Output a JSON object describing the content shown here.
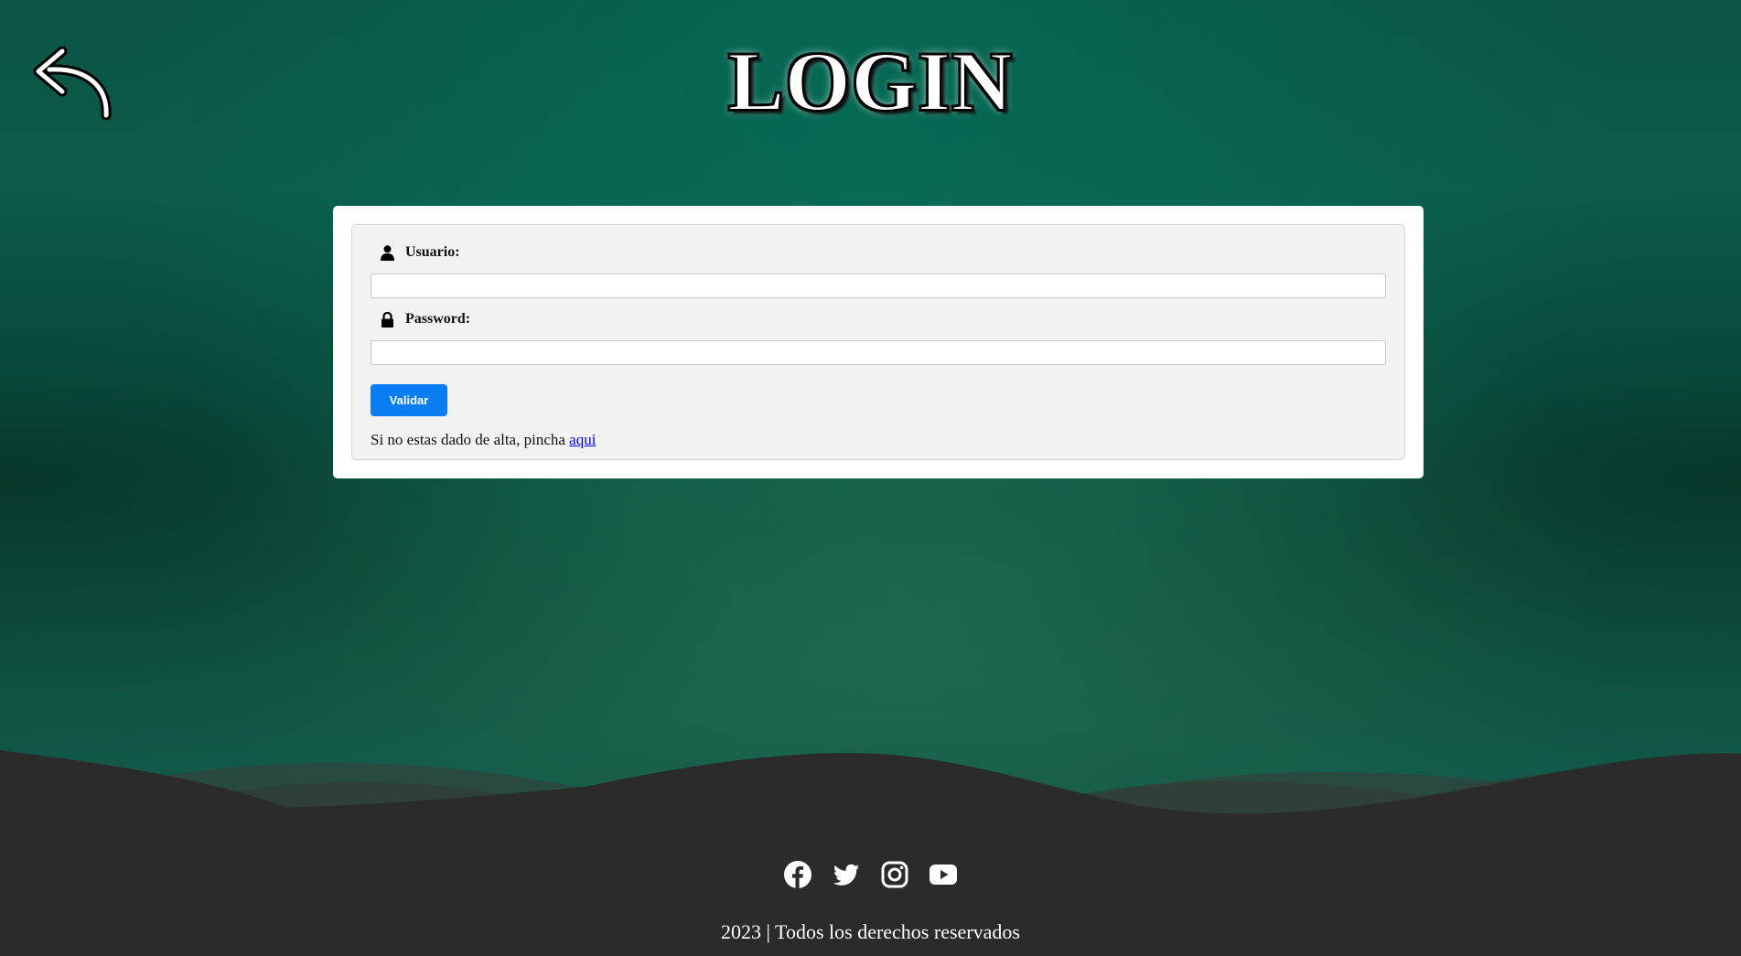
{
  "header": {
    "back_icon": "back-arrow-icon",
    "title": "LOGIN"
  },
  "form": {
    "username": {
      "icon": "user-icon",
      "label": "Usuario:",
      "value": "",
      "placeholder": ""
    },
    "password": {
      "icon": "lock-icon",
      "label": "Password:",
      "value": "",
      "placeholder": ""
    },
    "submit_label": "Validar",
    "submit_color": "#0a7df5",
    "signup_text": "Si no estas dado de alta, pincha",
    "signup_link": "aqui",
    "link_color": "#0000ee"
  },
  "footer": {
    "social_icons": [
      "facebook-icon",
      "twitter-icon",
      "instagram-icon",
      "youtube-icon"
    ],
    "copyright": "2023 | Todos los derechos reservados",
    "background_color": "#2b2b2b"
  },
  "theme": {
    "background_color": "#0d6451"
  }
}
